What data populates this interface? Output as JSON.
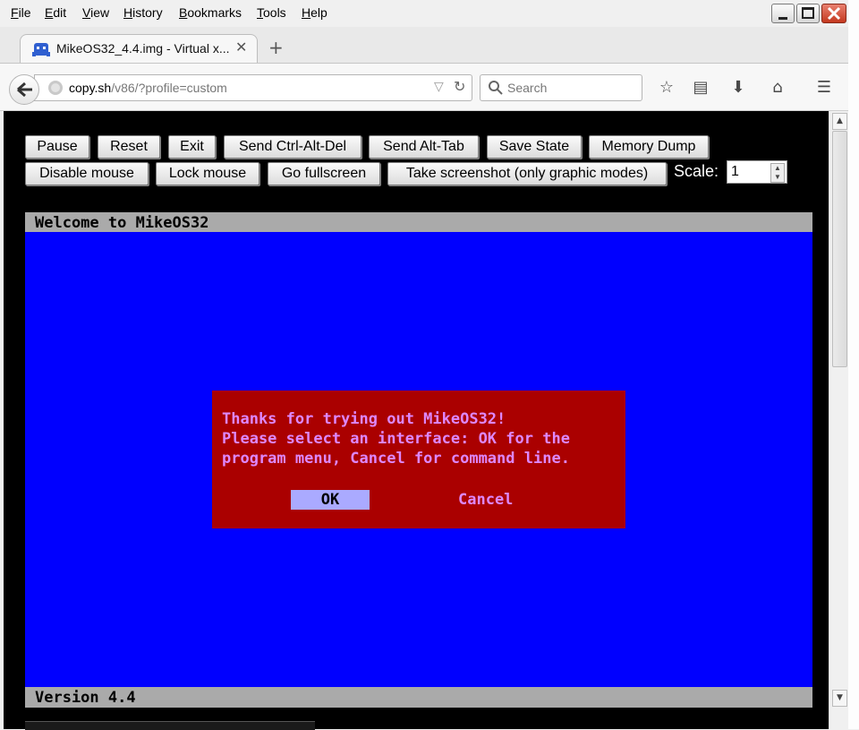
{
  "menubar": {
    "items": [
      {
        "label": "File",
        "mnemonic": "F",
        "rest": "ile"
      },
      {
        "label": "Edit",
        "mnemonic": "E",
        "rest": "dit"
      },
      {
        "label": "View",
        "mnemonic": "V",
        "rest": "iew"
      },
      {
        "label": "History",
        "mnemonic": "H",
        "rest": "istory"
      },
      {
        "label": "Bookmarks",
        "mnemonic": "B",
        "rest": "ookmarks"
      },
      {
        "label": "Tools",
        "mnemonic": "T",
        "rest": "ools"
      },
      {
        "label": "Help",
        "mnemonic": "H",
        "rest": "elp"
      }
    ]
  },
  "tab": {
    "title": "MikeOS32_4.4.img - Virtual x...",
    "close": "✕",
    "new_tab": "+"
  },
  "navbar": {
    "url_host": "copy.sh",
    "url_path": "/v86/?profile=custom",
    "search_placeholder": "Search"
  },
  "controls": {
    "row1": [
      "Pause",
      "Reset",
      "Exit",
      "Send Ctrl-Alt-Del",
      "Send Alt-Tab",
      "Save State",
      "Memory Dump"
    ],
    "row2": [
      "Disable mouse",
      "Lock mouse",
      "Go fullscreen",
      "Take screenshot (only graphic modes)"
    ],
    "scale_label": "Scale:",
    "scale_value": "1"
  },
  "screen": {
    "title": "Welcome to MikeOS32",
    "footer": "Version 4.4",
    "dialog": {
      "lines": [
        "Thanks for trying out MikeOS32!",
        "Please select an interface: OK for the",
        "program menu, Cancel for command line."
      ],
      "ok": "OK",
      "cancel": "Cancel"
    }
  },
  "colors": {
    "screen_bg": "#0000ff",
    "dialog_bg": "#aa0000",
    "bar_bg": "#aaaaaa",
    "ok_bg": "#aaaaff"
  }
}
